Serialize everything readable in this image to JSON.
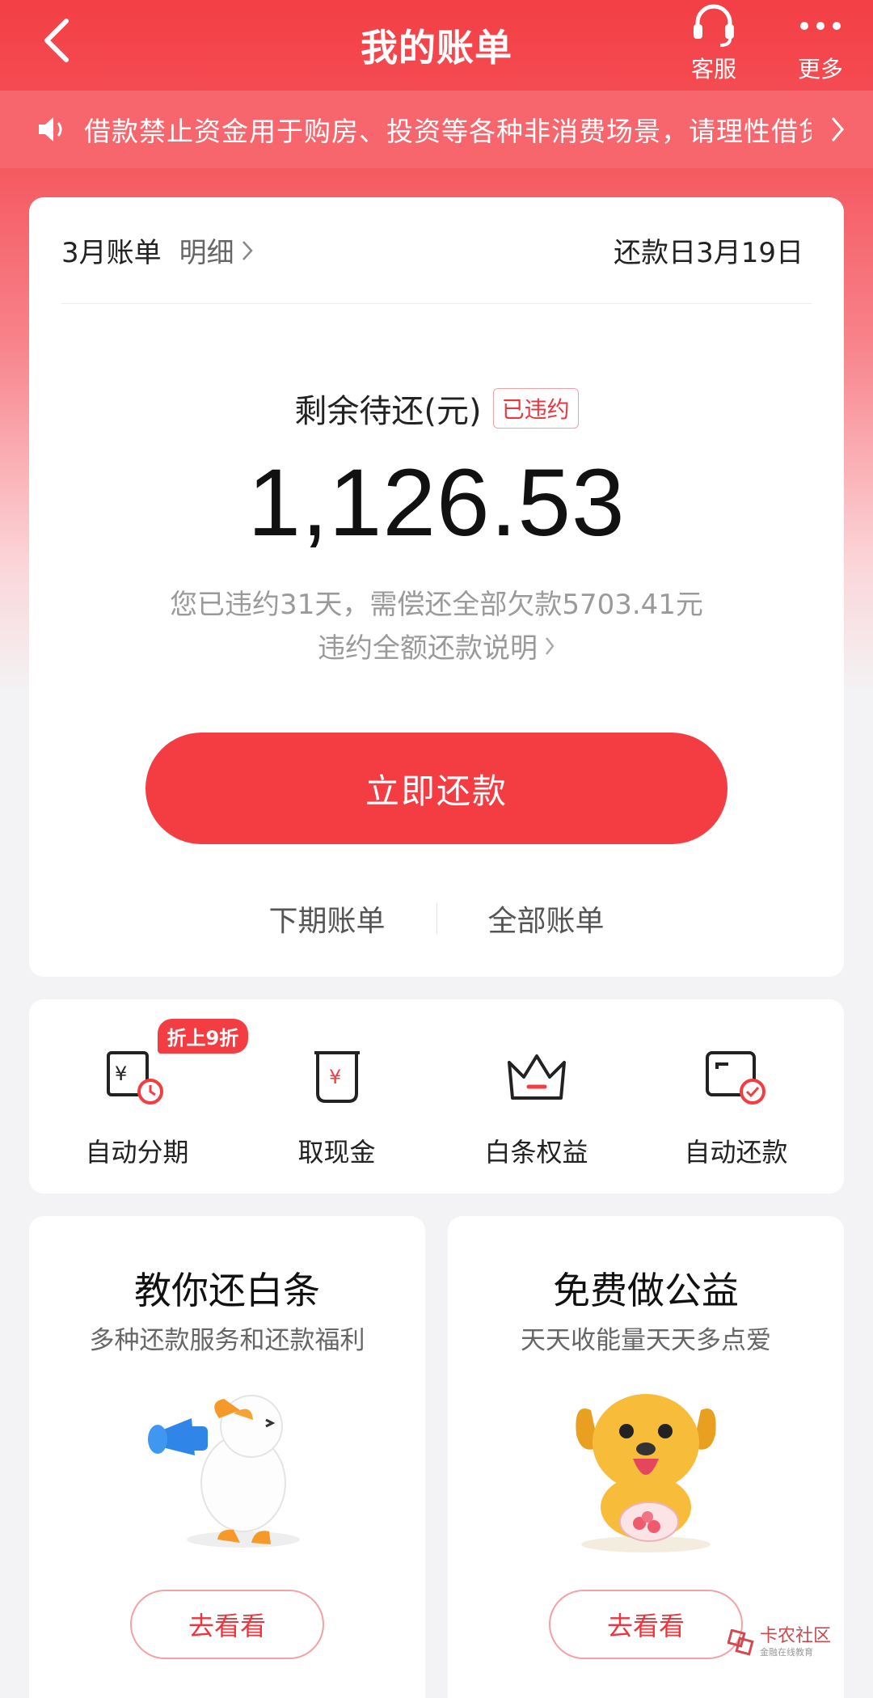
{
  "header": {
    "title": "我的账单",
    "customer_service_label": "客服",
    "more_label": "更多"
  },
  "notice": {
    "text": "借款禁止资金用于购房、投资等各种非消费场景，请理性借贷"
  },
  "bill": {
    "month_label": "3月账单",
    "detail_label": "明细",
    "due_date": "还款日3月19日",
    "remaining_label": "剩余待还(元)",
    "status_badge": "已违约",
    "amount": "1,126.53",
    "overdue_note": "您已违约31天，需偿还全部欠款5703.41元",
    "overdue_explain": "违约全额还款说明",
    "pay_button": "立即还款",
    "next_bill": "下期账单",
    "all_bills": "全部账单"
  },
  "actions": [
    {
      "label": "自动分期",
      "icon": "auto-installment-icon",
      "badge": "折上9折"
    },
    {
      "label": "取现金",
      "icon": "cash-withdraw-icon"
    },
    {
      "label": "白条权益",
      "icon": "crown-icon"
    },
    {
      "label": "自动还款",
      "icon": "auto-repay-icon"
    }
  ],
  "promos": [
    {
      "title": "教你还白条",
      "subtitle": "多种还款服务和还款福利",
      "button": "去看看",
      "art": "duck-megaphone-illustration"
    },
    {
      "title": "免费做公益",
      "subtitle": "天天收能量天天多点爱",
      "button": "去看看",
      "art": "dog-mascot-illustration"
    }
  ],
  "watermark": {
    "text": "卡农社区",
    "sub": "金融在线教育"
  },
  "colors": {
    "brand_red": "#f33d43",
    "notice_bg": "#f7666c",
    "page_bg": "#f3f3f5"
  }
}
